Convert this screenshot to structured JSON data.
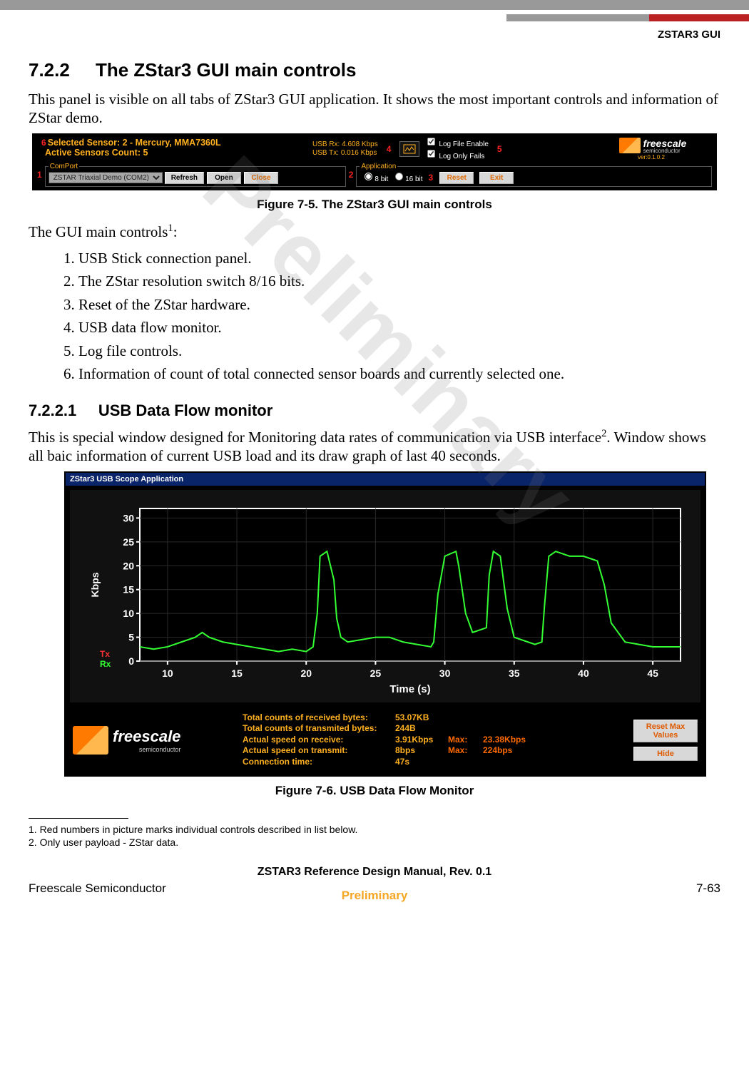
{
  "header": {
    "doc_tag": "ZSTAR3 GUI"
  },
  "section": {
    "num": "7.2.2",
    "title": "The ZStar3 GUI main controls",
    "intro": "This panel is visible on all tabs of ZStar3 GUI application. It shows the most important controls and information of ZStar demo."
  },
  "fig75_caption": "Figure 7-5. The ZStar3 GUI main controls",
  "fig75": {
    "selected_sensor": "Selected Sensor: 2 - Mercury, MMA7360L",
    "active_count": "Active Sensors Count: 5",
    "usb_rx": "USB Rx:   4.608 Kbps",
    "usb_tx": "USB Tx:   0.016 Kbps",
    "checks": {
      "log_file_enable": "Log File Enable",
      "log_only_fails": "Log Only Fails"
    },
    "annot": {
      "n1": "1",
      "n2": "2",
      "n3": "3",
      "n4": "4",
      "n5": "5",
      "n6": "6"
    },
    "comport": {
      "legend": "ComPort",
      "selected": "ZSTAR Triaxial Demo (COM2)",
      "refresh": "Refresh",
      "open": "Open",
      "close": "Close"
    },
    "application": {
      "legend": "Application",
      "bit8": "8 bit",
      "bit16": "16 bit",
      "reset": "Reset",
      "exit": "Exit"
    },
    "brand": "freescale",
    "brand_sub": "semiconductor",
    "version": "ver:0.1.0.2"
  },
  "controls_lead": "The GUI main controls",
  "controls_super": "1",
  "controls_colon": ":",
  "list": [
    "USB Stick connection panel.",
    "The ZStar resolution switch 8/16 bits.",
    "Reset of the ZStar hardware.",
    "USB data flow monitor.",
    "Log file controls.",
    "Information of count of total connected sensor boards and currently selected one."
  ],
  "subsection": {
    "num": "7.2.2.1",
    "title": "USB Data Flow monitor",
    "text_a": "This is special window designed for Monitoring data rates of communication via USB interface",
    "super": "2",
    "text_b": ". Window shows all baic information of current USB load and its draw graph of last 40 seconds."
  },
  "fig76_caption": "Figure 7-6. USB Data Flow Monitor",
  "fig76": {
    "titlebar": "ZStar3 USB Scope Application",
    "ylabel": "Kbps",
    "xlabel": "Time (s)",
    "tx": "Tx",
    "rx": "Rx",
    "brand": "freescale",
    "brand_sub": "semiconductor",
    "stats": {
      "l1": "Total counts of received bytes:",
      "v1": "53.07KB",
      "l2": "Total counts of transmited bytes:",
      "v2": "244B",
      "l3": "Actual speed on receive:",
      "v3": "3.91Kbps",
      "m3l": "Max:",
      "m3v": "23.38Kbps",
      "l4": "Actual speed on transmit:",
      "v4": "8bps",
      "m4l": "Max:",
      "m4v": "224bps",
      "l5": "Connection  time:",
      "v5": "47s"
    },
    "btn_reset": "Reset Max Values",
    "btn_hide": "Hide"
  },
  "chart_data": {
    "type": "line",
    "title": "ZStar3 USB Scope Application — Rx throughput",
    "xlabel": "Time (s)",
    "ylabel": "Kbps",
    "xlim": [
      8,
      47
    ],
    "ylim": [
      0,
      32
    ],
    "x_ticks": [
      10,
      15,
      20,
      25,
      30,
      35,
      40,
      45
    ],
    "y_ticks": [
      0,
      5,
      10,
      15,
      20,
      25,
      30
    ],
    "series": [
      {
        "name": "Rx",
        "color": "#33ff33",
        "x": [
          8,
          9,
          10,
          11,
          12,
          12.5,
          13,
          14,
          15,
          16,
          17,
          18,
          19,
          20,
          20.5,
          20.8,
          21,
          21.5,
          22,
          22.2,
          22.5,
          23,
          24,
          25,
          26,
          27,
          28,
          29,
          29.2,
          29.5,
          30,
          30.8,
          31,
          31.5,
          32,
          33,
          33.2,
          33.5,
          34,
          34.5,
          35,
          36,
          36.5,
          37,
          37.2,
          37.5,
          38,
          39,
          40,
          41,
          41.5,
          42,
          43,
          44,
          45,
          46,
          47
        ],
        "y": [
          3,
          2.5,
          3,
          4,
          5,
          6,
          5,
          4,
          3.5,
          3,
          2.5,
          2,
          2.5,
          2,
          3,
          10,
          22,
          23,
          17,
          9,
          5,
          4,
          4.5,
          5,
          5,
          4,
          3.5,
          3,
          4,
          14,
          22,
          23,
          20,
          10,
          6,
          7,
          18,
          23,
          22,
          11,
          5,
          4,
          3.5,
          4,
          12,
          22,
          23,
          22,
          22,
          21,
          16,
          8,
          4,
          3.5,
          3,
          3,
          3
        ]
      }
    ]
  },
  "footnotes": {
    "f1": "1. Red numbers in picture marks individual controls described in list below.",
    "f2": "2. Only user payload - ZStar data."
  },
  "footer": {
    "manual": "ZSTAR3 Reference Design Manual, Rev. 0.1",
    "left": "Freescale Semiconductor",
    "right": "7-63",
    "preliminary": "Preliminary"
  },
  "watermark": "Preliminary"
}
